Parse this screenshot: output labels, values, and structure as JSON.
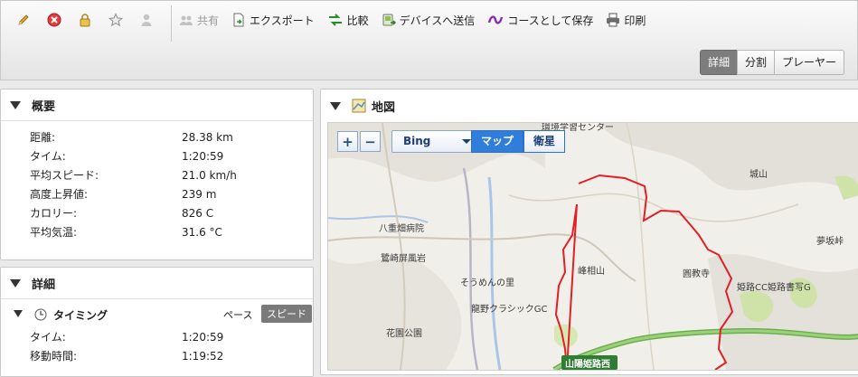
{
  "toolbar": {
    "icons": [
      {
        "name": "edit",
        "icon": "pencil-icon"
      },
      {
        "name": "delete",
        "icon": "delete-icon"
      },
      {
        "name": "lock",
        "icon": "lock-icon"
      },
      {
        "name": "favorite",
        "icon": "star-icon"
      },
      {
        "name": "person",
        "icon": "person-icon"
      }
    ],
    "actions": {
      "share": "共有",
      "export": "エクスポート",
      "compare": "比較",
      "send_to_device": "デバイスへ送信",
      "save_as_course": "コースとして保存",
      "print": "印刷"
    },
    "view_tabs": {
      "details": "詳細",
      "split": "分割",
      "player": "プレーヤー"
    }
  },
  "overview": {
    "title": "概要",
    "rows": [
      {
        "label": "距離:",
        "value": "28.38 km"
      },
      {
        "label": "タイム:",
        "value": "1:20:59"
      },
      {
        "label": "平均スピード:",
        "value": "21.0 km/h"
      },
      {
        "label": "高度上昇値:",
        "value": "239 m"
      },
      {
        "label": "カロリー:",
        "value": "826 C"
      },
      {
        "label": "平均気温:",
        "value": "31.6 °C"
      }
    ]
  },
  "details": {
    "title": "詳細",
    "timing": {
      "title": "タイミング",
      "pace_label": "ペース",
      "speed_label": "スピード",
      "rows": [
        {
          "label": "タイム:",
          "value": "1:20:59"
        },
        {
          "label": "移動時間:",
          "value": "1:19:52"
        }
      ]
    }
  },
  "map": {
    "title": "地図",
    "zoom_in": "+",
    "zoom_out": "−",
    "provider": "Bing",
    "type_map": "マップ",
    "type_satellite": "衛星",
    "labels": {
      "l1": "環境学習センター",
      "l2": "城山",
      "l3": "八重畑病院",
      "l4": "鷺崎屏風岩",
      "l5": "そうめんの里",
      "l6": "峰相山",
      "l7": "圓教寺",
      "l8": "姫路CC姫路書写G",
      "l9": "龍野クラシックGC",
      "l10": "花園公園",
      "l11": "山陽姫路西",
      "l12": "夢坂峠"
    },
    "colors": {
      "route": "#e21f26",
      "highway": "#6ab04c",
      "water": "#a9c6e8"
    }
  }
}
